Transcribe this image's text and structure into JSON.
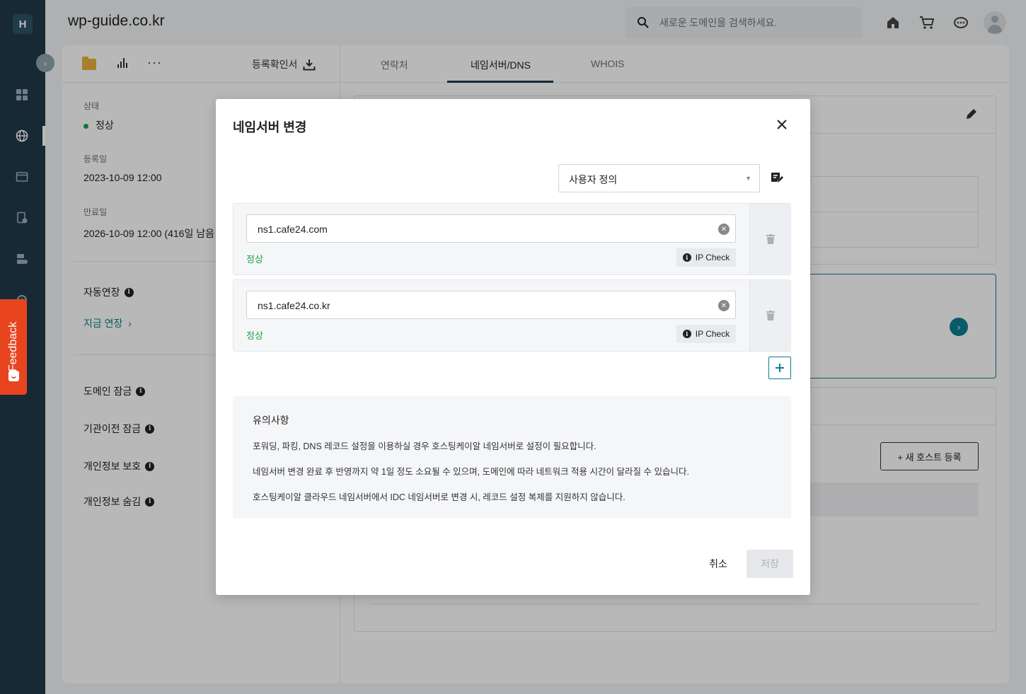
{
  "app": {
    "logo_letter": "H"
  },
  "header": {
    "domain_title": "wp-guide.co.kr",
    "search_placeholder": "새로운 도메인을 검색하세요."
  },
  "sidebar": {
    "icons": [
      "dashboard-icon",
      "globe-icon",
      "window-icon",
      "document-check-icon",
      "server-icon",
      "gear-icon"
    ],
    "feedback_label": "Feedback"
  },
  "left_panel": {
    "register_cert_label": "등록확인서",
    "status_label": "상태",
    "status_value": "정상",
    "registered_label": "등록일",
    "registered_value": "2023-10-09 12:00",
    "expiry_label": "만료일",
    "expiry_value": "2026-10-09 12:00 (416일 남음",
    "auto_renew_label": "자동연장",
    "renew_now_label": "지금 연장",
    "options": [
      {
        "label": "도메인 잠금"
      },
      {
        "label": "기관이전 잠금"
      },
      {
        "label": "개인정보 보호"
      },
      {
        "label": "개인정보 숨김"
      }
    ]
  },
  "tabs": [
    {
      "label": "연락처",
      "active": false
    },
    {
      "label": "네임서버/DNS",
      "active": true
    },
    {
      "label": "WHOIS",
      "active": false
    }
  ],
  "background": {
    "new_host_button": "+ 새 호스트 등록"
  },
  "modal": {
    "title": "네임서버 변경",
    "select_value": "사용자 정의",
    "nameservers": [
      {
        "value": "ns1.cafe24.com",
        "status": "정상",
        "ip_check_label": "IP Check"
      },
      {
        "value": "ns1.cafe24.co.kr",
        "status": "정상",
        "ip_check_label": "IP Check"
      }
    ],
    "notice": {
      "title": "유의사항",
      "lines": [
        "포워딩, 파킹, DNS 레코드 설정을 이용하실 경우 호스팅케이알 네임서버로 설정이 필요합니다.",
        "네임서버 변경 완료 후 반영까지 약 1일 정도 소요될 수 있으며, 도메인에 따라 네트워크 적용 시간이 달라질 수 있습니다.",
        "호스팅케이알 클라우드 네임서버에서 IDC 네임서버로 변경 시, 레코드 설정 복제를 지원하지 않습니다."
      ]
    },
    "cancel_label": "취소",
    "save_label": "저장"
  },
  "colors": {
    "sidebar": "#1f3a4a",
    "accent": "#0c7f8f",
    "status_ok": "#1aa34a",
    "feedback": "#e8451f"
  }
}
